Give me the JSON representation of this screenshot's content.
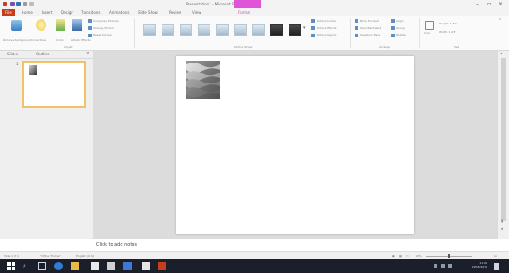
{
  "window": {
    "title": "Presentation1 - Microsoft PowerPoint",
    "context_tab": ""
  },
  "tabs": {
    "file": "File",
    "items": [
      "Home",
      "Insert",
      "Design",
      "Transitions",
      "Animations",
      "Slide Show",
      "Review",
      "View",
      "Format"
    ]
  },
  "ribbon": {
    "groups": [
      "Adjust",
      "Picture Styles",
      "Arrange",
      "Size"
    ],
    "adjust_labels": [
      "Remove Background",
      "Corrections",
      "Color",
      "Artistic Effects"
    ],
    "adjust_small": [
      "Compress Pictures",
      "Change Picture",
      "Reset Picture"
    ],
    "style_small": [
      "Picture Border",
      "Picture Effects",
      "Picture Layout"
    ],
    "arrange_small": [
      "Bring Forward",
      "Send Backward",
      "Selection Pane"
    ],
    "align_small": [
      "Align",
      "Group",
      "Rotate"
    ],
    "size": {
      "crop": "Crop",
      "height": "Height: 1.83\"",
      "width": "Width: 1.45\""
    }
  },
  "left_pane": {
    "tabs": [
      "Slides",
      "Outline"
    ],
    "close": "×",
    "slide_number": "1"
  },
  "notes": {
    "placeholder": "Click to add notes"
  },
  "status": {
    "slide": "Slide 1 of 1",
    "theme": "\"Office Theme\"",
    "language": "English (U.S.)",
    "zoom": "69%"
  },
  "taskbar": {
    "time": "11:06",
    "date": "29/08/2016"
  },
  "colors": {
    "file_tab": "#c43e1c",
    "context_tab": "#e055d8",
    "thumb_border": "#f2c26b",
    "taskbar": "#1a1f2a"
  }
}
